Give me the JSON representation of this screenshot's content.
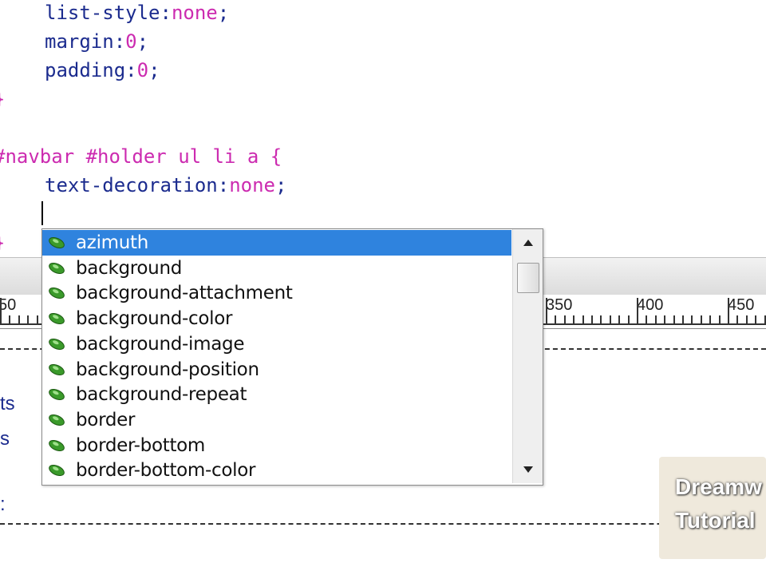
{
  "code": {
    "line1": {
      "prop": "list-style",
      "value": "none"
    },
    "line2": {
      "prop": "margin",
      "value": "0"
    },
    "line3": {
      "prop": "padding",
      "value": "0"
    },
    "close_brace": "}",
    "selector": "#navbar #holder ul li a {",
    "line5": {
      "prop": "text-decoration",
      "value": "none"
    },
    "close_brace2": "}"
  },
  "ruler": {
    "labels": [
      "50",
      "350",
      "400",
      "450"
    ]
  },
  "side_fragments": [
    "ts",
    "s",
    ":"
  ],
  "autocomplete": {
    "selected_index": 0,
    "items": [
      "azimuth",
      "background",
      "background-attachment",
      "background-color",
      "background-image",
      "background-position",
      "background-repeat",
      "border",
      "border-bottom",
      "border-bottom-color"
    ],
    "icon": "css-property-icon",
    "selection_color": "#2f83de"
  },
  "watermark": {
    "line1": "Dreamw",
    "line2": "Tutorial"
  }
}
